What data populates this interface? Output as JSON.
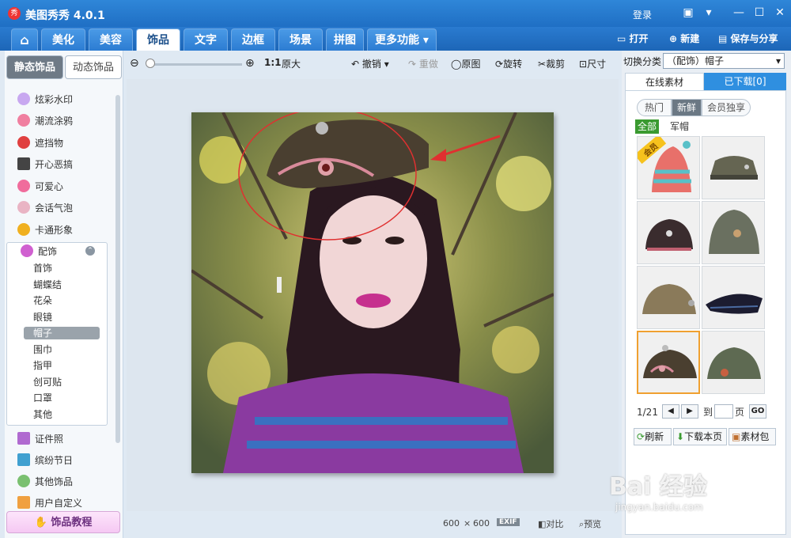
{
  "app": {
    "title": "美图秀秀 4.0.1",
    "logo_text": "秀",
    "login": "登录"
  },
  "nav": {
    "tabs": [
      "美化",
      "美容",
      "饰品",
      "文字",
      "边框",
      "场景",
      "拼图",
      "更多功能"
    ],
    "active": "饰品",
    "home_icon": "home-icon"
  },
  "right_tools": {
    "open": "打开",
    "new": "新建",
    "save_share": "保存与分享"
  },
  "left": {
    "tabs": {
      "static": "静态饰品",
      "dynamic": "动态饰品"
    },
    "categories": [
      "炫彩水印",
      "潮流涂鸦",
      "遮挡物",
      "开心恶搞",
      "可爱心",
      "会话气泡",
      "卡通形象"
    ],
    "accessory_group": "配饰",
    "accessory_items": [
      "首饰",
      "蝴蝶结",
      "花朵",
      "眼镜",
      "帽子",
      "围巾",
      "指甲",
      "创可贴",
      "口罩",
      "其他"
    ],
    "selected_sub": "帽子",
    "more_categories": [
      "证件照",
      "缤纷节日",
      "其他饰品",
      "用户自定义"
    ],
    "tutorial": "饰品教程"
  },
  "toolbar": {
    "zoom_ratio": "1:1",
    "original_size": "原大",
    "undo": "撤销",
    "redo": "重做",
    "original": "原图",
    "rotate": "旋转",
    "crop": "裁剪",
    "resize": "尺寸"
  },
  "status": {
    "width": "600",
    "sep": "×",
    "height": "600",
    "exif": "EXIF",
    "compare": "对比",
    "preview": "预览"
  },
  "right": {
    "switch_label": "切换分类",
    "category_value": "（配饰）帽子",
    "tabs": {
      "online": "在线素材",
      "downloaded": "已下载[0]"
    },
    "filters": [
      "热门",
      "新鲜",
      "会员独享"
    ],
    "active_filter": "新鲜",
    "subcats": [
      "全部",
      "军帽"
    ],
    "member_badge": "会员",
    "pager": {
      "page": "1/21",
      "to": "到",
      "page_unit": "页",
      "go": "GO"
    },
    "actions": {
      "refresh": "刷新",
      "download_page": "下载本页",
      "material_pack": "素材包"
    }
  },
  "watermark": {
    "line1": "Bai 经验",
    "line2": "jingyan.baidu.com"
  },
  "colors": {
    "titlebar": "#2f86d8",
    "accent": "#1f6fc4",
    "selected_thumb": "#f0a030",
    "annotation": "#e03030"
  }
}
